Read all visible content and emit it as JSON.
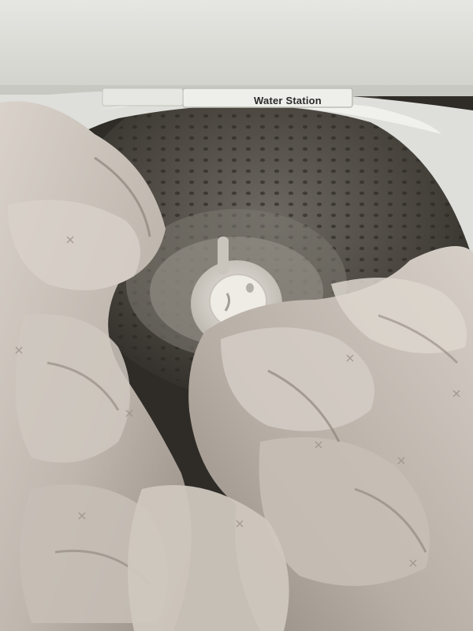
{
  "label": {
    "text": "Water Station"
  },
  "colors": {
    "lid": "#dcdcd6",
    "tub_dark": "#3b3833",
    "agitator": "#d8d4cc",
    "fabric_light": "#d3ccc4",
    "fabric_mid": "#b1a9a0",
    "fabric_shadow": "#8a8179"
  }
}
